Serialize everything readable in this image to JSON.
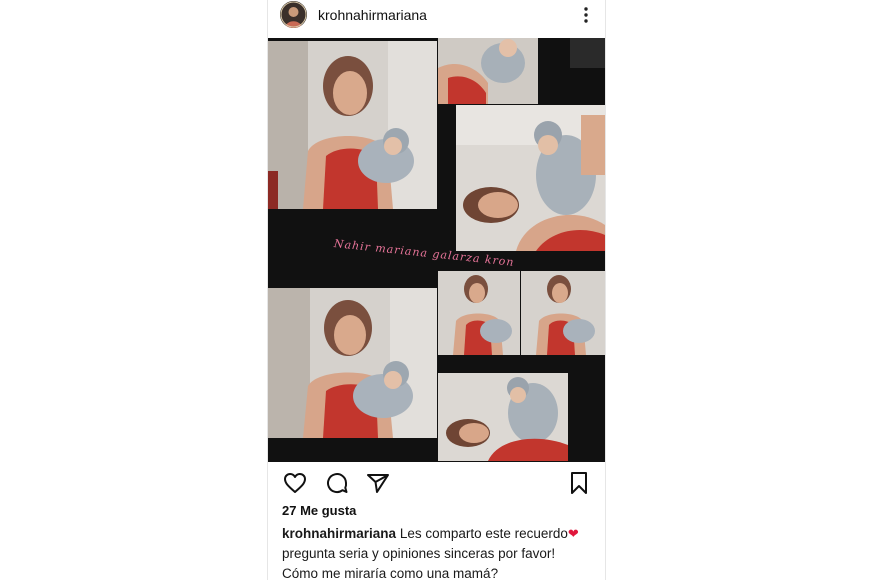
{
  "post": {
    "username": "krohnahirmariana",
    "more_icon": "more-vertical-icon",
    "image": {
      "overlay_text": "Nahir mariana galarza kron",
      "photos": [
        "mother-holding-baby",
        "mother-holding-baby-crop",
        "mother-with-baby-tilted",
        "mother-holding-baby",
        "mother-holding-baby-small",
        "mother-holding-baby-small",
        "mother-with-baby-tilted-small"
      ]
    },
    "actions": {
      "like_icon": "heart-outline-icon",
      "comment_icon": "comment-bubble-icon",
      "share_icon": "paper-plane-icon",
      "save_icon": "bookmark-icon"
    },
    "likes_text": "27 Me gusta",
    "caption": {
      "username": "krohnahirmariana",
      "line1": "Les comparto este recuerdo",
      "emoji": "❤",
      "line2": "pregunta seria y opiniones sinceras por favor!",
      "line3": "Cómo me miraría como una  mamá?"
    },
    "colors": {
      "text": "#111111",
      "overlay_text": "#ff7fa8",
      "media_background": "#111111",
      "heart_emoji": "#e0173c"
    }
  }
}
